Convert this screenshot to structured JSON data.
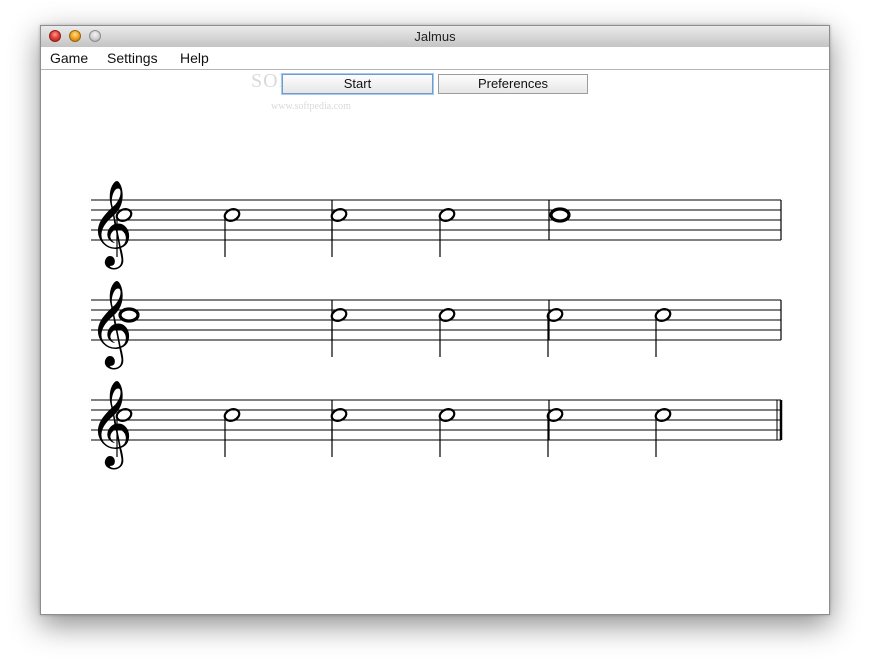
{
  "window": {
    "title": "Jalmus"
  },
  "menu": {
    "items": [
      "Game",
      "Settings",
      "Help"
    ]
  },
  "toolbar": {
    "start_label": "Start",
    "preferences_label": "Preferences"
  },
  "watermark": {
    "text": "SOFTPEDIA",
    "sub": "www.softpedia.com"
  },
  "score": {
    "clef": "treble",
    "final_barline": "double",
    "staves": [
      {
        "measures": [
          {
            "notes": [
              {
                "type": "half"
              },
              {
                "type": "half"
              }
            ]
          },
          {
            "notes": [
              {
                "type": "half"
              },
              {
                "type": "half"
              }
            ]
          },
          {
            "notes": [
              {
                "type": "whole"
              }
            ]
          }
        ]
      },
      {
        "measures": [
          {
            "notes": [
              {
                "type": "whole"
              }
            ]
          },
          {
            "notes": [
              {
                "type": "half"
              },
              {
                "type": "half"
              }
            ]
          },
          {
            "notes": [
              {
                "type": "half"
              },
              {
                "type": "half"
              }
            ]
          }
        ]
      },
      {
        "measures": [
          {
            "notes": [
              {
                "type": "half"
              },
              {
                "type": "half"
              }
            ]
          },
          {
            "notes": [
              {
                "type": "half"
              },
              {
                "type": "half"
              }
            ]
          },
          {
            "notes": [
              {
                "type": "half"
              },
              {
                "type": "half"
              }
            ]
          }
        ]
      }
    ]
  }
}
